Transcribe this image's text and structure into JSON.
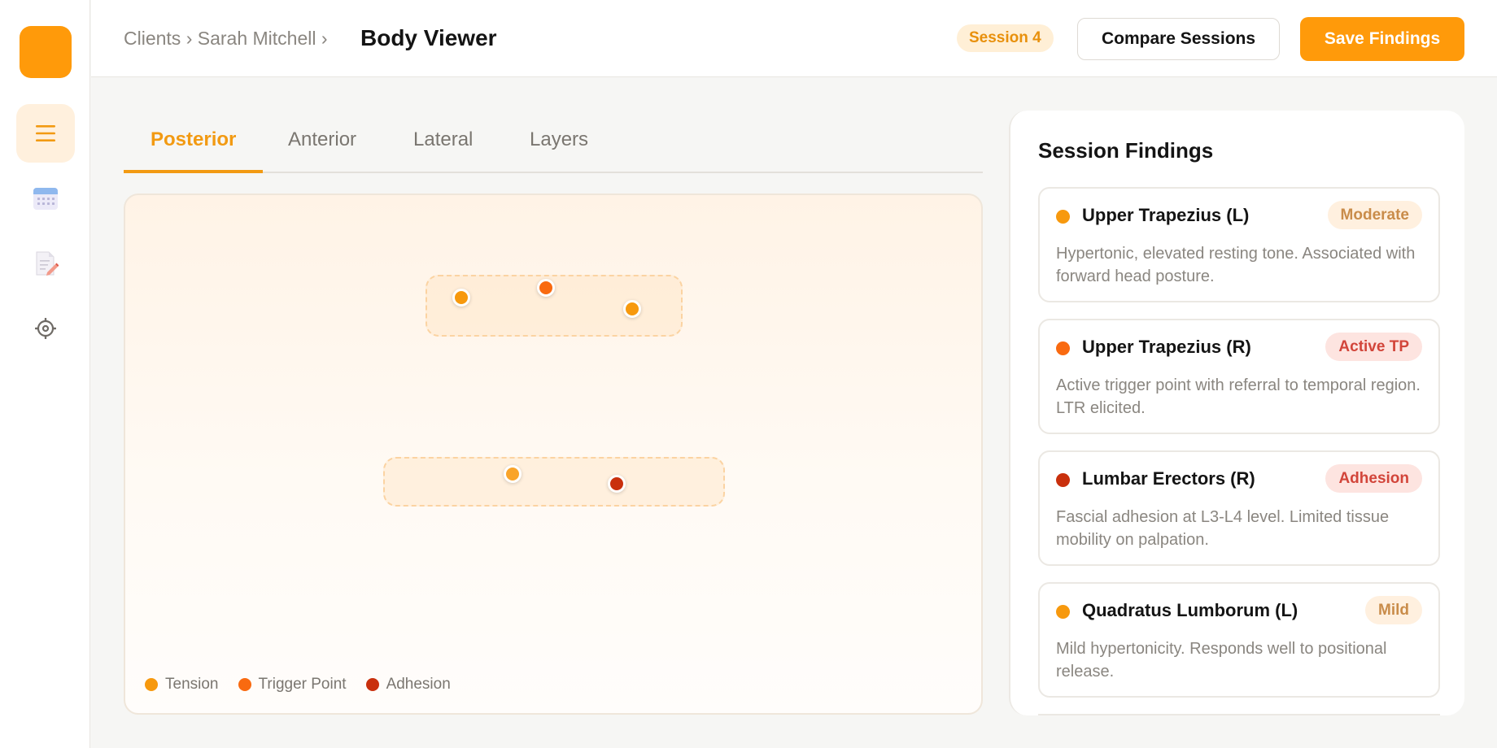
{
  "colors": {
    "accent": "#ff9a0a",
    "tension": "#f7990e",
    "trigger_point": "#f96a10",
    "adhesion": "#c9300d"
  },
  "sidebar": {
    "items": [
      {
        "icon": "menu-icon",
        "active": true
      },
      {
        "icon": "calendar-icon",
        "active": false
      },
      {
        "icon": "document-edit-icon",
        "active": false
      },
      {
        "icon": "settings-icon",
        "active": false
      }
    ]
  },
  "header": {
    "breadcrumb": "Clients › Sarah Mitchell ›",
    "title": "Body Viewer",
    "session_badge": "Session 4",
    "compare_label": "Compare Sessions",
    "save_label": "Save Findings"
  },
  "tabs": [
    {
      "label": "Posterior",
      "active": true
    },
    {
      "label": "Anterior",
      "active": false
    },
    {
      "label": "Lateral",
      "active": false
    },
    {
      "label": "Layers",
      "active": false
    }
  ],
  "viewer": {
    "legend": [
      {
        "label": "Tension",
        "color": "#f7990e"
      },
      {
        "label": "Trigger Point",
        "color": "#f96a10"
      },
      {
        "label": "Adhesion",
        "color": "#c9300d"
      }
    ]
  },
  "findings_panel": {
    "title": "Session Findings",
    "findings": [
      {
        "name": "Upper Trapezius (L)",
        "tag": "Moderate",
        "type": "tension",
        "description": "Hypertonic, elevated resting tone. Associated with forward head posture."
      },
      {
        "name": "Upper Trapezius (R)",
        "tag": "Active TP",
        "type": "trigger_point",
        "description": "Active trigger point with referral to temporal region. LTR elicited."
      },
      {
        "name": "Lumbar Erectors (R)",
        "tag": "Adhesion",
        "type": "adhesion",
        "description": "Fascial adhesion at L3-L4 level. Limited tissue mobility on palpation."
      },
      {
        "name": "Quadratus Lumborum (L)",
        "tag": "Mild",
        "type": "tension",
        "description": "Mild hypertonicity. Responds well to positional release."
      }
    ]
  }
}
